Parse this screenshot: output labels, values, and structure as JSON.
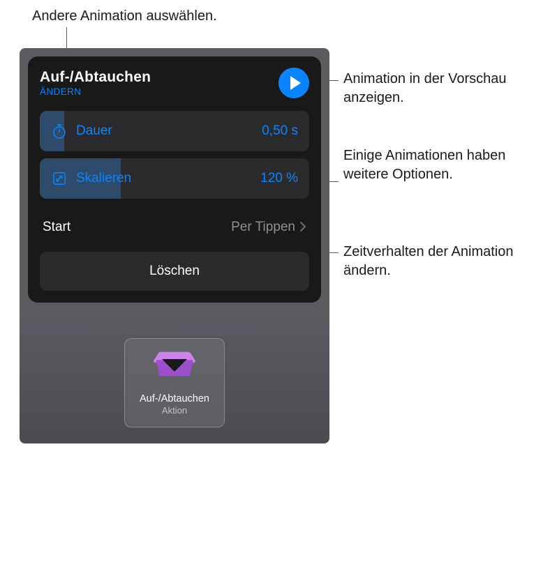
{
  "callouts": {
    "change": "Andere Animation auswählen.",
    "preview": "Animation in der Vorschau anzeigen.",
    "options": "Einige Animationen haben weitere Optionen.",
    "timing": "Zeitverhalten der Animation ändern."
  },
  "popover": {
    "title": "Auf-/Abtauchen",
    "change_label": "ÄNDERN",
    "duration": {
      "label": "Dauer",
      "value": "0,50 s"
    },
    "scale": {
      "label": "Skalieren",
      "value": "120 %"
    },
    "start": {
      "label": "Start",
      "value": "Per Tippen"
    },
    "delete_label": "Löschen"
  },
  "token": {
    "label": "Auf-/Abtauchen",
    "sublabel": "Aktion"
  }
}
